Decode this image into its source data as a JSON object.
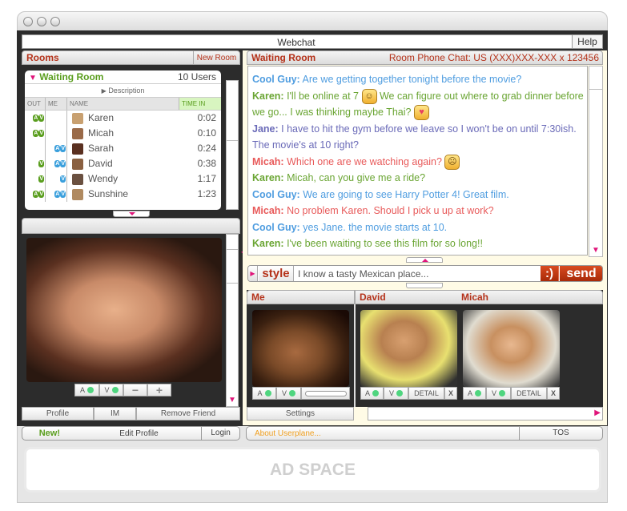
{
  "window": {
    "title": "Webchat",
    "help_label": "Help"
  },
  "rooms_panel": {
    "title": "Rooms",
    "new_room_label": "New Room",
    "room": {
      "name": "Waiting Room",
      "user_count": "10 Users",
      "description_label": "Description",
      "columns": [
        "OUT",
        "ME",
        "NAME",
        "TIME IN"
      ],
      "users": [
        {
          "name": "Karen",
          "time_in": "0:02",
          "out": "AV",
          "me": ""
        },
        {
          "name": "Micah",
          "time_in": "0:10",
          "out": "AV",
          "me": ""
        },
        {
          "name": "Sarah",
          "time_in": "0:24",
          "out": "",
          "me": "AV"
        },
        {
          "name": "David",
          "time_in": "0:38",
          "out": "V",
          "me": "AV"
        },
        {
          "name": "Wendy",
          "time_in": "1:17",
          "out": "V",
          "me": "V"
        },
        {
          "name": "Sunshine",
          "time_in": "1:23",
          "out": "AV",
          "me": "AV"
        }
      ]
    }
  },
  "friend_video": {
    "controls": {
      "audio_label": "A",
      "video_label": "V",
      "minus_label": "−",
      "plus_label": "+"
    },
    "actions": [
      "Profile",
      "IM",
      "Remove Friend"
    ]
  },
  "chat": {
    "room_title": "Waiting Room",
    "phone_info": "Room Phone Chat: US (XXX)XXX-XXX x 123456",
    "messages": [
      {
        "sender": "Cool Guy:",
        "text": " Are we getting together tonight before the movie?",
        "color": "#4f9de0"
      },
      {
        "sender": "Karen:",
        "text": " I'll be online at 7 ",
        "emoji": "smile",
        "text2": " We can figure out where to grab dinner before we go... I was thinking maybe Thai? ",
        "emoji2": "heart",
        "color": "#6aa533"
      },
      {
        "sender": "Jane:",
        "text": " I have to hit the gym before we leave so I won't be on until 7:30ish. The movie's at 10 right?",
        "color": "#6a6ab8"
      },
      {
        "sender": "Micah:",
        "text": " Which one are we watching again? ",
        "emoji": "confused",
        "color": "#e85a5a"
      },
      {
        "sender": "Karen:",
        "text": " Micah, can you give me a ride?",
        "color": "#6aa533"
      },
      {
        "sender": "Cool Guy:",
        "text": " We are going to see Harry Potter 4! Great film.",
        "color": "#4f9de0"
      },
      {
        "sender": "Micah:",
        "text": " No problem Karen. Should I pick u up at work?",
        "color": "#e85a5a"
      },
      {
        "sender": "Cool Guy:",
        "text": " yes Jane. the movie starts at 10.",
        "color": "#4f9de0"
      },
      {
        "sender": "Karen:",
        "text": " I've been waiting to see this film for so long!!",
        "color": "#6aa533"
      }
    ],
    "style_label": "style",
    "input_value": "I know a tasty Mexican place...",
    "emoticon_label": ":)",
    "send_label": "send"
  },
  "video_panel": {
    "me_label": "Me",
    "others": [
      "David",
      "Micah"
    ],
    "audio_label": "A",
    "video_label": "V",
    "detail_label": "DETAIL",
    "close_label": "X",
    "settings_label": "Settings"
  },
  "footer": {
    "new_label": "New!",
    "edit_profile_label": "Edit Profile",
    "login_label": "Login",
    "about_label": "About Userplane...",
    "tos_label": "TOS",
    "ad_label": "AD SPACE"
  },
  "colors": {
    "accent_red": "#b5321a",
    "send_red": "#c8360f",
    "green": "#5a9e1e",
    "blue": "#3a9fdc",
    "magenta": "#e0157a",
    "status_green": "#4fd57f"
  }
}
